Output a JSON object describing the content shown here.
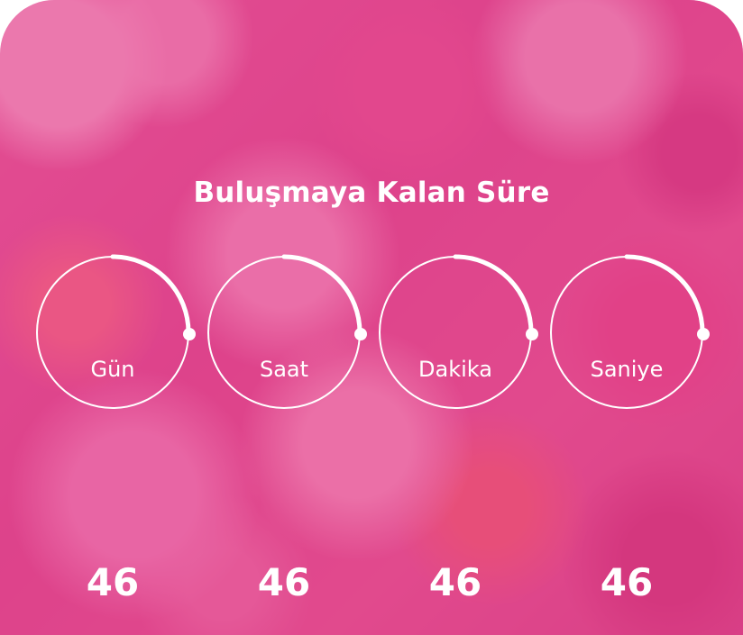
{
  "title": "Buluşmaya Kalan Süre",
  "timers": [
    {
      "value": "46",
      "label": "Gün",
      "progress_fraction": 0.25
    },
    {
      "value": "46",
      "label": "Saat",
      "progress_fraction": 0.25
    },
    {
      "value": "46",
      "label": "Dakika",
      "progress_fraction": 0.25
    },
    {
      "value": "46",
      "label": "Saniye",
      "progress_fraction": 0.25
    }
  ],
  "colors": {
    "accent": "#e2468c",
    "text": "#ffffff"
  }
}
